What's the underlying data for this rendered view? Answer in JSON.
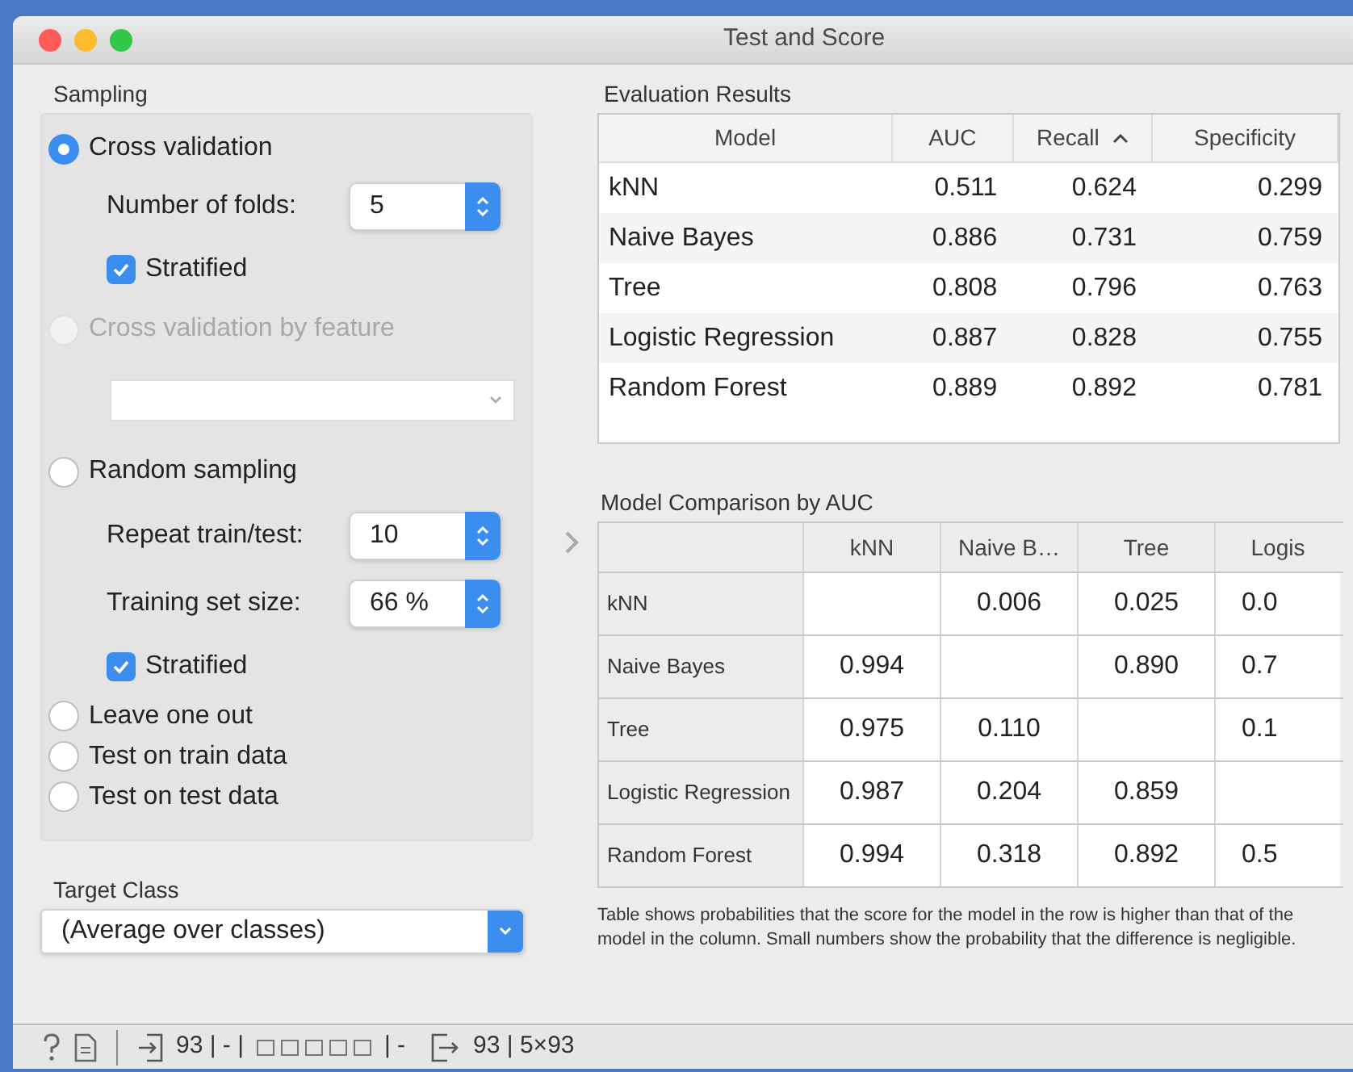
{
  "window": {
    "title": "Test and Score"
  },
  "sampling": {
    "title": "Sampling",
    "options": [
      {
        "label": "Cross validation",
        "selected": true,
        "disabled": false,
        "settings": [
          {
            "kind": "spin",
            "label": "Number of folds:",
            "value": "5"
          },
          {
            "kind": "checkbox",
            "label": "Stratified",
            "checked": true
          }
        ]
      },
      {
        "label": "Cross validation by feature",
        "selected": false,
        "disabled": true,
        "settings": [
          {
            "kind": "combo"
          }
        ]
      },
      {
        "label": "Random sampling",
        "selected": false,
        "disabled": false,
        "settings": [
          {
            "kind": "spin",
            "label": "Repeat train/test:",
            "value": "10"
          },
          {
            "kind": "spin",
            "label": "Training set size:",
            "value": "66 %"
          },
          {
            "kind": "checkbox",
            "label": "Stratified",
            "checked": true
          }
        ]
      },
      {
        "label": "Leave one out",
        "selected": false,
        "disabled": false
      },
      {
        "label": "Test on train data",
        "selected": false,
        "disabled": false
      },
      {
        "label": "Test on test data",
        "selected": false,
        "disabled": false
      }
    ]
  },
  "target_class": {
    "title": "Target Class",
    "value": "(Average over classes)"
  },
  "evaluation": {
    "title": "Evaluation Results",
    "columns": [
      {
        "label": "Model",
        "sorted": false
      },
      {
        "label": "AUC",
        "sorted": false
      },
      {
        "label": "Recall",
        "sorted": true
      },
      {
        "label": "Specificity",
        "sorted": false
      }
    ],
    "rows": [
      [
        "kNN",
        "0.511",
        "0.624",
        "0.299"
      ],
      [
        "Naive Bayes",
        "0.886",
        "0.731",
        "0.759"
      ],
      [
        "Tree",
        "0.808",
        "0.796",
        "0.763"
      ],
      [
        "Logistic Regression",
        "0.887",
        "0.828",
        "0.755"
      ],
      [
        "Random Forest",
        "0.889",
        "0.892",
        "0.781"
      ]
    ]
  },
  "comparison": {
    "title": "Model Comparison by AUC",
    "columns": [
      "kNN",
      "Naive B…",
      "Tree",
      "Logis"
    ],
    "rows": [
      {
        "label": "kNN",
        "cells": [
          null,
          "0.006",
          "0.025",
          "0.0"
        ]
      },
      {
        "label": "Naive Bayes",
        "cells": [
          "0.994",
          null,
          "0.890",
          "0.7"
        ]
      },
      {
        "label": "Tree",
        "cells": [
          "0.975",
          "0.110",
          null,
          "0.1"
        ]
      },
      {
        "label": "Logistic Regression",
        "cells": [
          "0.987",
          "0.204",
          "0.859",
          null
        ]
      },
      {
        "label": "Random Forest",
        "cells": [
          "0.994",
          "0.318",
          "0.892",
          "0.5"
        ]
      }
    ],
    "caption": "Table shows probabilities that the score for the model in the row is higher than that of the model in the column. Small numbers show the probability that the difference is negligible."
  },
  "status_bar": {
    "input": "93 | - |",
    "input_tail": "| -",
    "output": "93 | 5×93"
  }
}
